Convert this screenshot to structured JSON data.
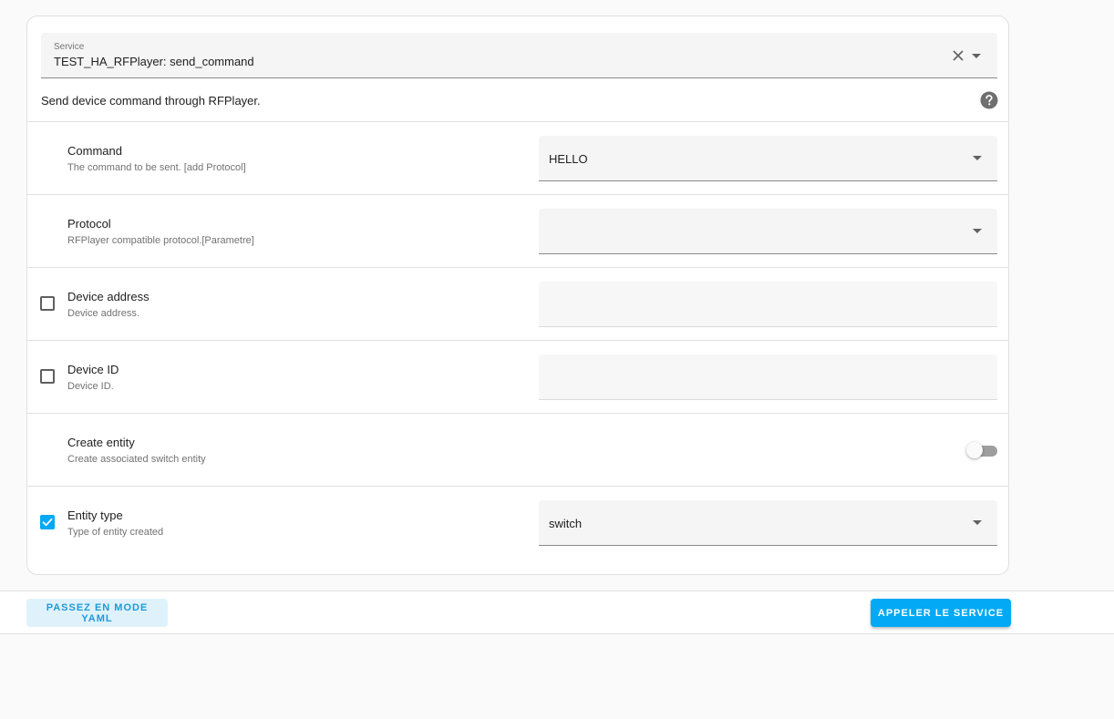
{
  "service": {
    "label": "Service",
    "value": "TEST_HA_RFPlayer: send_command",
    "description": "Send device command through RFPlayer."
  },
  "fields": {
    "command": {
      "title": "Command",
      "description": "The command to be sent. [add Protocol]",
      "value": "HELLO"
    },
    "protocol": {
      "title": "Protocol",
      "description": "RFPlayer compatible protocol.[Parametre]",
      "value": ""
    },
    "device_address": {
      "title": "Device address",
      "description": "Device address.",
      "value": "",
      "enabled": false
    },
    "device_id": {
      "title": "Device ID",
      "description": "Device ID.",
      "value": "",
      "enabled": false
    },
    "create_entity": {
      "title": "Create entity",
      "description": "Create associated switch entity",
      "toggle_on": false
    },
    "entity_type": {
      "title": "Entity type",
      "description": "Type of entity created",
      "value": "switch",
      "enabled": true
    }
  },
  "footer": {
    "yaml_label": "PASSEZ EN MODE YAML",
    "call_label": "APPELER LE SERVICE"
  },
  "colors": {
    "accent": "#03a9f4",
    "accent_light": "#dff2fc",
    "text_primary": "#212121",
    "text_secondary": "#727272"
  },
  "icons": {
    "clear": "close-icon",
    "dropdown": "chevron-down-icon",
    "help": "help-circle-icon",
    "check": "check-icon"
  }
}
